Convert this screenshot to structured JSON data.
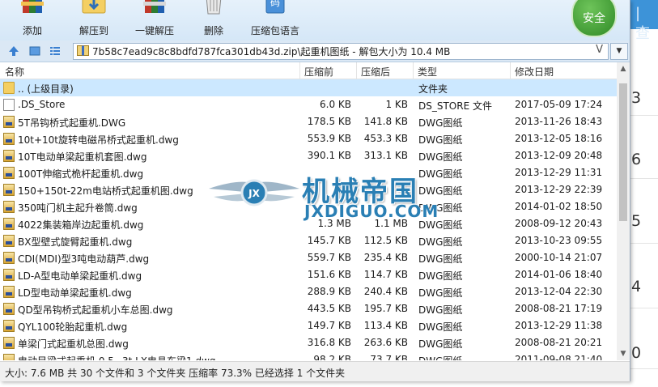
{
  "toolbar": {
    "buttons": [
      {
        "label": "添加",
        "icon": "add-books-icon"
      },
      {
        "label": "解压到",
        "icon": "extract-folder-icon"
      },
      {
        "label": "一键解压",
        "icon": "one-click-extract-icon"
      },
      {
        "label": "删除",
        "icon": "trash-icon"
      },
      {
        "label": "压缩包语言",
        "icon": "archive-language-icon"
      }
    ],
    "security_badge": "安全"
  },
  "address_bar": {
    "path": "7b58c7ead9c8c8bdfd787fca301db43d.zip\\起重机图纸 - 解包大小为 10.4 MB",
    "dropdown_glyph": "V"
  },
  "columns": {
    "name": "名称",
    "size": "压缩前",
    "packed": "压缩后",
    "type": "类型",
    "modified": "修改日期"
  },
  "files": [
    {
      "name": ".. (上级目录)",
      "size": "",
      "packed": "",
      "type": "文件夹",
      "modified": "",
      "icon": "folder"
    },
    {
      "name": ".DS_Store",
      "size": "6.0 KB",
      "packed": "1 KB",
      "type": "DS_STORE 文件",
      "modified": "2017-05-09 17:24",
      "icon": "file"
    },
    {
      "name": "5T吊钩桥式起重机.DWG",
      "size": "178.5 KB",
      "packed": "141.8 KB",
      "type": "DWG图纸",
      "modified": "2013-11-26 18:43",
      "icon": "dwg"
    },
    {
      "name": "10t+10t旋转电磁吊桥式起重机.dwg",
      "size": "553.9 KB",
      "packed": "453.3 KB",
      "type": "DWG图纸",
      "modified": "2013-12-05 18:16",
      "icon": "dwg"
    },
    {
      "name": "10T电动单梁起重机套图.dwg",
      "size": "390.1 KB",
      "packed": "313.1 KB",
      "type": "DWG图纸",
      "modified": "2013-12-09 20:48",
      "icon": "dwg"
    },
    {
      "name": "100T伸缩式桅杆起重机.dwg",
      "size": "",
      "packed": "",
      "type": "DWG图纸",
      "modified": "2013-12-29 11:31",
      "icon": "dwg"
    },
    {
      "name": "150+150t-22m电站桥式起重机图.dwg",
      "size": "",
      "packed": "",
      "type": "DWG图纸",
      "modified": "2013-12-29 22:39",
      "icon": "dwg"
    },
    {
      "name": "350吨门机主起升卷筒.dwg",
      "size": "",
      "packed": "",
      "type": "DWG图纸",
      "modified": "2014-01-02 18:50",
      "icon": "dwg"
    },
    {
      "name": "4022集装箱岸边起重机.dwg",
      "size": "1.3 MB",
      "packed": "1.1 MB",
      "type": "DWG图纸",
      "modified": "2008-09-12 20:43",
      "icon": "dwg"
    },
    {
      "name": "BX型壁式旋臂起重机.dwg",
      "size": "145.7 KB",
      "packed": "112.5 KB",
      "type": "DWG图纸",
      "modified": "2013-10-23 09:55",
      "icon": "dwg"
    },
    {
      "name": "CDI(MDI)型3吨电动葫芦.dwg",
      "size": "559.7 KB",
      "packed": "235.4 KB",
      "type": "DWG图纸",
      "modified": "2000-10-14 21:07",
      "icon": "dwg"
    },
    {
      "name": "LD-A型电动单梁起重机.dwg",
      "size": "151.6 KB",
      "packed": "114.7 KB",
      "type": "DWG图纸",
      "modified": "2014-01-06 18:40",
      "icon": "dwg"
    },
    {
      "name": "LD型电动单梁起重机.dwg",
      "size": "288.9 KB",
      "packed": "240.4 KB",
      "type": "DWG图纸",
      "modified": "2013-12-04 22:30",
      "icon": "dwg"
    },
    {
      "name": "QD型吊钩桥式起重机小车总图.dwg",
      "size": "443.5 KB",
      "packed": "195.7 KB",
      "type": "DWG图纸",
      "modified": "2008-08-21 17:19",
      "icon": "dwg"
    },
    {
      "name": "QYL100轮胎起重机.dwg",
      "size": "149.7 KB",
      "packed": "113.4 KB",
      "type": "DWG图纸",
      "modified": "2013-12-29 11:38",
      "icon": "dwg"
    },
    {
      "name": "单梁门式起重机总图.dwg",
      "size": "316.8 KB",
      "packed": "263.6 KB",
      "type": "DWG图纸",
      "modified": "2008-08-21 20:21",
      "icon": "dwg"
    },
    {
      "name": "电动目梁式起重机 0.5~3t LX电县东梁1.dwg",
      "size": "98.2 KB",
      "packed": "73.7 KB",
      "type": "DWG图纸",
      "modified": "2011-09-08 21:40",
      "icon": "dwg"
    }
  ],
  "selected_index": 0,
  "status": "大小: 7.6 MB 共 30 个文件和 3 个文件夹 压缩率 73.3% 已经选择 1 个文件夹",
  "watermark": {
    "cn": "机械帝国",
    "en": "JXDIGUO.COM"
  },
  "background_page": {
    "tab_text": "| 查",
    "numbers": [
      "3",
      "6",
      "5",
      "4",
      "0"
    ]
  },
  "colors": {
    "toolbar_bg": "#d5e7f7",
    "selection": "#cce8ff",
    "security_green": "#3a9a2e",
    "watermark_blue": "#2a7fb4"
  }
}
